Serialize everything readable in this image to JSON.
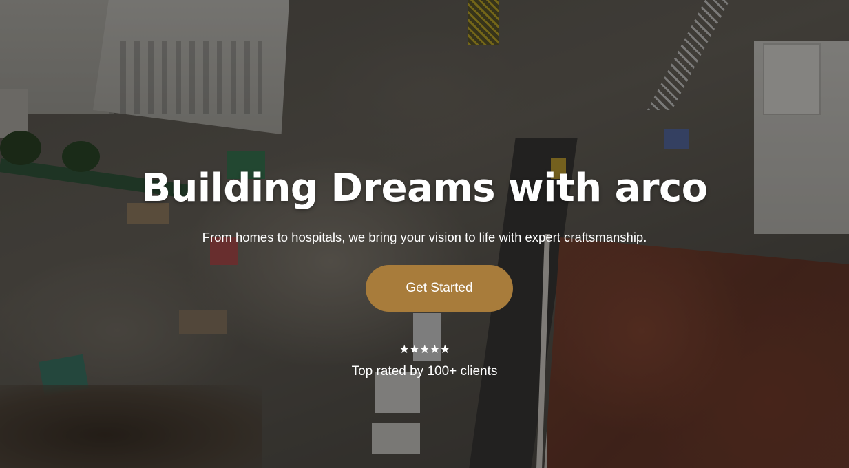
{
  "hero": {
    "title": "Building Dreams with arco",
    "subtitle": "From homes to hospitals, we bring your vision to life with expert craftsmanship.",
    "cta_label": "Get Started",
    "rating_stars": "★★★★★",
    "rating_count": 5,
    "rating_text": "Top rated by 100+ clients"
  },
  "colors": {
    "accent": "#a87c3b",
    "text": "#ffffff",
    "overlay": "rgba(0,0,0,0.42)"
  },
  "icons": {
    "stars": "star-icon"
  }
}
